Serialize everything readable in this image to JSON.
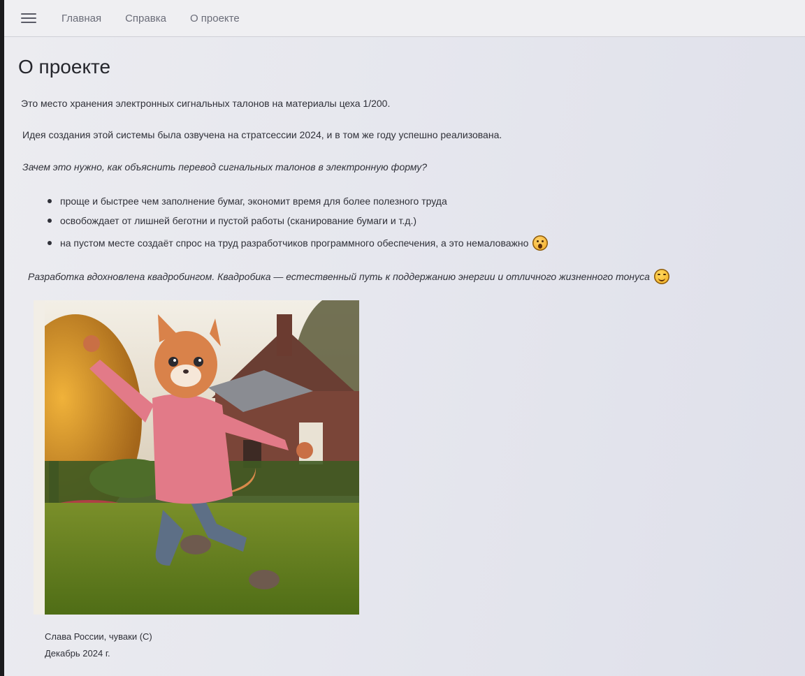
{
  "nav": {
    "menu_icon": "hamburger-menu-icon",
    "links": [
      "Главная",
      "Справка",
      "О проекте"
    ]
  },
  "page": {
    "title": "О проекте",
    "p1": "Это место хранения электронных сигнальных талонов на материалы цеха 1/200.",
    "p2": "Идея создания этой системы была озвучена на стратсессии 2024, и в том же году успешно реализована.",
    "question": "Зачем это нужно, как объяснить перевод сигнальных талонов в электронную форму?",
    "bullets": [
      "проще и быстрее чем заполнение бумаг, экономит время для более полезного труда",
      "освобождает от лишней беготни и пустой работы (сканирование бумаги и т.д.)",
      "на пустом месте создаёт спрос на труд разработчиков программного обеспечения, а это немаловажно"
    ],
    "bullet3_emoji": "astonished-face-emoji",
    "inspiration": "Разработка вдохновлена квадробингом. Квадробика — естественный путь к поддержанию энергии и отличного жизненного тонуса",
    "inspiration_emoji": "winking-face-emoji",
    "image": "jumping-cat-person-in-garden-photo",
    "caption1": "Слава России, чуваки (С)",
    "caption2": "Декабрь 2024 г."
  },
  "colors": {
    "background": "#e6e7ee",
    "navbar": "#efeff2",
    "text": "#2f3038",
    "nav_link": "#6a6c78"
  }
}
